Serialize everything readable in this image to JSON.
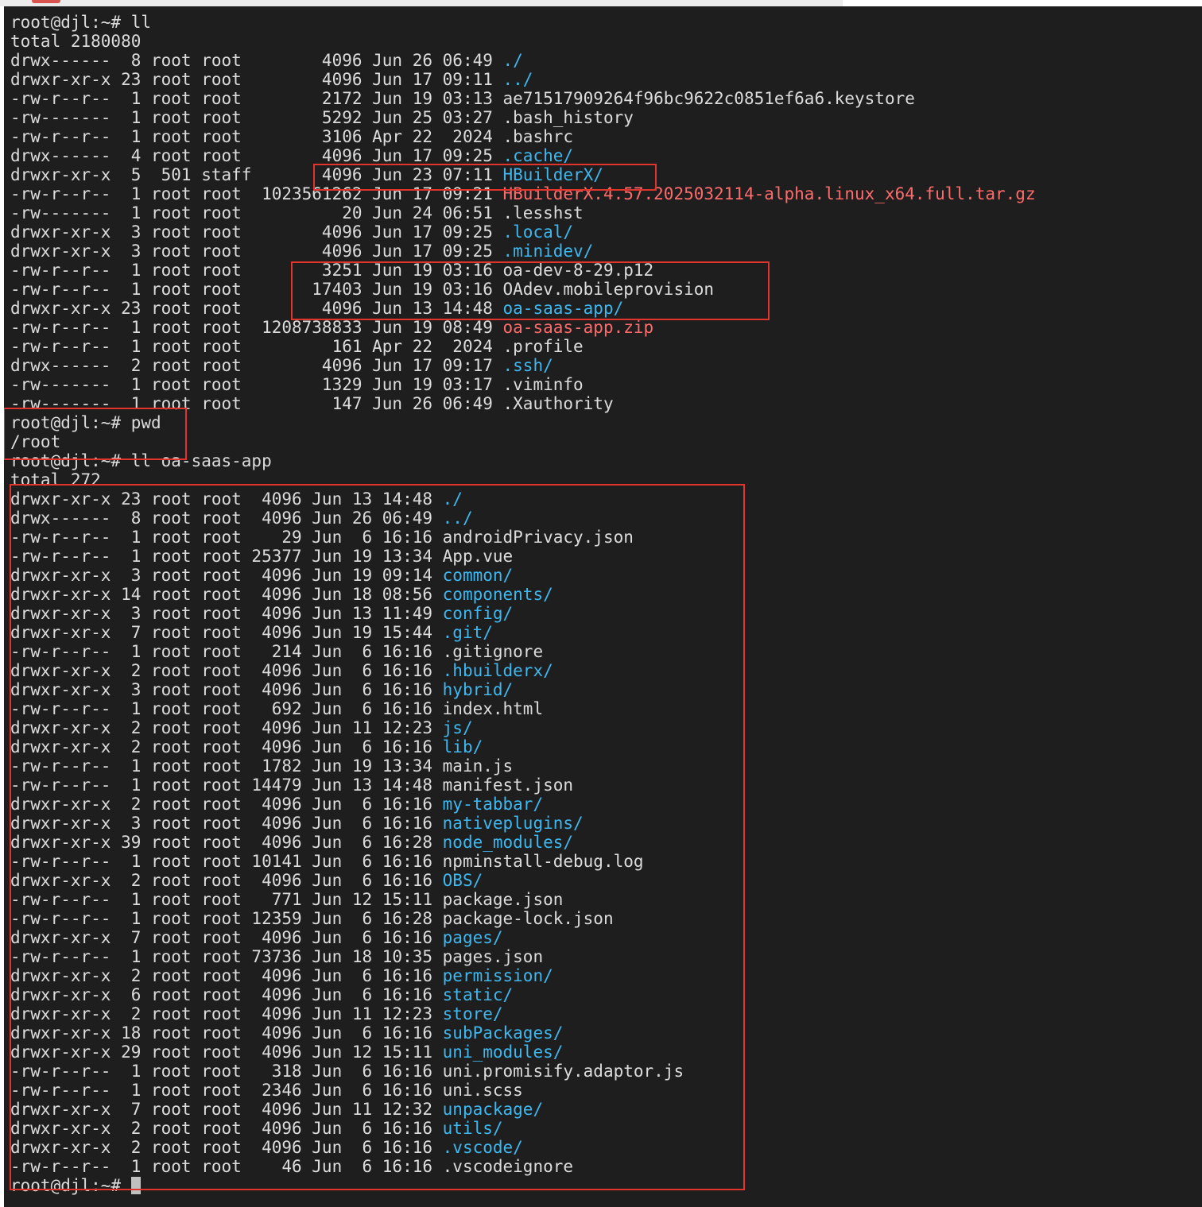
{
  "colors": {
    "background": "#1e1e1e",
    "text": "#dcdcdc",
    "directory": "#3eb8f0",
    "archive": "#ff6b6b",
    "highlight": "#e0342d"
  },
  "lines": [
    {
      "type": "prompt",
      "text": "root@djl:~# ll"
    },
    {
      "type": "plain",
      "text": "total 2180080"
    },
    {
      "type": "entry",
      "prefix": "drwx------  8 root root        4096 Jun 26 06:49 ",
      "name": "./",
      "kind": "dir"
    },
    {
      "type": "entry",
      "prefix": "drwxr-xr-x 23 root root        4096 Jun 17 09:11 ",
      "name": "../",
      "kind": "dir"
    },
    {
      "type": "entry",
      "prefix": "-rw-r--r--  1 root root        2172 Jun 19 03:13 ",
      "name": "ae71517909264f96bc9622c0851ef6a6.keystore",
      "kind": "file"
    },
    {
      "type": "entry",
      "prefix": "-rw-------  1 root root        5292 Jun 25 03:27 ",
      "name": ".bash_history",
      "kind": "file"
    },
    {
      "type": "entry",
      "prefix": "-rw-r--r--  1 root root        3106 Apr 22  2024 ",
      "name": ".bashrc",
      "kind": "file"
    },
    {
      "type": "entry",
      "prefix": "drwx------  4 root root        4096 Jun 17 09:25 ",
      "name": ".cache/",
      "kind": "dir"
    },
    {
      "type": "entry",
      "prefix": "drwxr-xr-x  5  501 staff       4096 Jun 23 07:11 ",
      "name": "HBuilderX/",
      "kind": "dir"
    },
    {
      "type": "entry",
      "prefix": "-rw-r--r--  1 root root  1023561262 Jun 17 09:21 ",
      "name": "HBuilderX.4.57.2025032114-alpha.linux_x64.full.tar.gz",
      "kind": "archive"
    },
    {
      "type": "entry",
      "prefix": "-rw-------  1 root root          20 Jun 24 06:51 ",
      "name": ".lesshst",
      "kind": "file"
    },
    {
      "type": "entry",
      "prefix": "drwxr-xr-x  3 root root        4096 Jun 17 09:25 ",
      "name": ".local/",
      "kind": "dir"
    },
    {
      "type": "entry",
      "prefix": "drwxr-xr-x  3 root root        4096 Jun 17 09:25 ",
      "name": ".minidev/",
      "kind": "dir"
    },
    {
      "type": "entry",
      "prefix": "-rw-r--r--  1 root root        3251 Jun 19 03:16 ",
      "name": "oa-dev-8-29.p12",
      "kind": "file"
    },
    {
      "type": "entry",
      "prefix": "-rw-r--r--  1 root root       17403 Jun 19 03:16 ",
      "name": "OAdev.mobileprovision",
      "kind": "file"
    },
    {
      "type": "entry",
      "prefix": "drwxr-xr-x 23 root root        4096 Jun 13 14:48 ",
      "name": "oa-saas-app/",
      "kind": "dir"
    },
    {
      "type": "entry",
      "prefix": "-rw-r--r--  1 root root  1208738833 Jun 19 08:49 ",
      "name": "oa-saas-app.zip",
      "kind": "archive"
    },
    {
      "type": "entry",
      "prefix": "-rw-r--r--  1 root root         161 Apr 22  2024 ",
      "name": ".profile",
      "kind": "file"
    },
    {
      "type": "entry",
      "prefix": "drwx------  2 root root        4096 Jun 17 09:17 ",
      "name": ".ssh/",
      "kind": "dir"
    },
    {
      "type": "entry",
      "prefix": "-rw-------  1 root root        1329 Jun 19 03:17 ",
      "name": ".viminfo",
      "kind": "file"
    },
    {
      "type": "entry",
      "prefix": "-rw-------  1 root root         147 Jun 26 06:49 ",
      "name": ".Xauthority",
      "kind": "file"
    },
    {
      "type": "prompt",
      "text": "root@djl:~# pwd"
    },
    {
      "type": "plain",
      "text": "/root"
    },
    {
      "type": "prompt",
      "text": "root@djl:~# ll oa-saas-app"
    },
    {
      "type": "plain",
      "text": "total 272"
    },
    {
      "type": "entry",
      "prefix": "drwxr-xr-x 23 root root  4096 Jun 13 14:48 ",
      "name": "./",
      "kind": "dir"
    },
    {
      "type": "entry",
      "prefix": "drwx------  8 root root  4096 Jun 26 06:49 ",
      "name": "../",
      "kind": "dir"
    },
    {
      "type": "entry",
      "prefix": "-rw-r--r--  1 root root    29 Jun  6 16:16 ",
      "name": "androidPrivacy.json",
      "kind": "file"
    },
    {
      "type": "entry",
      "prefix": "-rw-r--r--  1 root root 25377 Jun 19 13:34 ",
      "name": "App.vue",
      "kind": "file"
    },
    {
      "type": "entry",
      "prefix": "drwxr-xr-x  3 root root  4096 Jun 19 09:14 ",
      "name": "common/",
      "kind": "dir"
    },
    {
      "type": "entry",
      "prefix": "drwxr-xr-x 14 root root  4096 Jun 18 08:56 ",
      "name": "components/",
      "kind": "dir"
    },
    {
      "type": "entry",
      "prefix": "drwxr-xr-x  3 root root  4096 Jun 13 11:49 ",
      "name": "config/",
      "kind": "dir"
    },
    {
      "type": "entry",
      "prefix": "drwxr-xr-x  7 root root  4096 Jun 19 15:44 ",
      "name": ".git/",
      "kind": "dir"
    },
    {
      "type": "entry",
      "prefix": "-rw-r--r--  1 root root   214 Jun  6 16:16 ",
      "name": ".gitignore",
      "kind": "file"
    },
    {
      "type": "entry",
      "prefix": "drwxr-xr-x  2 root root  4096 Jun  6 16:16 ",
      "name": ".hbuilderx/",
      "kind": "dir"
    },
    {
      "type": "entry",
      "prefix": "drwxr-xr-x  3 root root  4096 Jun  6 16:16 ",
      "name": "hybrid/",
      "kind": "dir"
    },
    {
      "type": "entry",
      "prefix": "-rw-r--r--  1 root root   692 Jun  6 16:16 ",
      "name": "index.html",
      "kind": "file"
    },
    {
      "type": "entry",
      "prefix": "drwxr-xr-x  2 root root  4096 Jun 11 12:23 ",
      "name": "js/",
      "kind": "dir"
    },
    {
      "type": "entry",
      "prefix": "drwxr-xr-x  2 root root  4096 Jun  6 16:16 ",
      "name": "lib/",
      "kind": "dir"
    },
    {
      "type": "entry",
      "prefix": "-rw-r--r--  1 root root  1782 Jun 19 13:34 ",
      "name": "main.js",
      "kind": "file"
    },
    {
      "type": "entry",
      "prefix": "-rw-r--r--  1 root root 14479 Jun 13 14:48 ",
      "name": "manifest.json",
      "kind": "file"
    },
    {
      "type": "entry",
      "prefix": "drwxr-xr-x  2 root root  4096 Jun  6 16:16 ",
      "name": "my-tabbar/",
      "kind": "dir"
    },
    {
      "type": "entry",
      "prefix": "drwxr-xr-x  3 root root  4096 Jun  6 16:16 ",
      "name": "nativeplugins/",
      "kind": "dir"
    },
    {
      "type": "entry",
      "prefix": "drwxr-xr-x 39 root root  4096 Jun  6 16:28 ",
      "name": "node_modules/",
      "kind": "dir"
    },
    {
      "type": "entry",
      "prefix": "-rw-r--r--  1 root root 10141 Jun  6 16:16 ",
      "name": "npminstall-debug.log",
      "kind": "file"
    },
    {
      "type": "entry",
      "prefix": "drwxr-xr-x  2 root root  4096 Jun  6 16:16 ",
      "name": "OBS/",
      "kind": "dir"
    },
    {
      "type": "entry",
      "prefix": "-rw-r--r--  1 root root   771 Jun 12 15:11 ",
      "name": "package.json",
      "kind": "file"
    },
    {
      "type": "entry",
      "prefix": "-rw-r--r--  1 root root 12359 Jun  6 16:28 ",
      "name": "package-lock.json",
      "kind": "file"
    },
    {
      "type": "entry",
      "prefix": "drwxr-xr-x  7 root root  4096 Jun  6 16:16 ",
      "name": "pages/",
      "kind": "dir"
    },
    {
      "type": "entry",
      "prefix": "-rw-r--r--  1 root root 73736 Jun 18 10:35 ",
      "name": "pages.json",
      "kind": "file"
    },
    {
      "type": "entry",
      "prefix": "drwxr-xr-x  2 root root  4096 Jun  6 16:16 ",
      "name": "permission/",
      "kind": "dir"
    },
    {
      "type": "entry",
      "prefix": "drwxr-xr-x  6 root root  4096 Jun  6 16:16 ",
      "name": "static/",
      "kind": "dir"
    },
    {
      "type": "entry",
      "prefix": "drwxr-xr-x  2 root root  4096 Jun 11 12:23 ",
      "name": "store/",
      "kind": "dir"
    },
    {
      "type": "entry",
      "prefix": "drwxr-xr-x 18 root root  4096 Jun  6 16:16 ",
      "name": "subPackages/",
      "kind": "dir"
    },
    {
      "type": "entry",
      "prefix": "drwxr-xr-x 29 root root  4096 Jun 12 15:11 ",
      "name": "uni_modules/",
      "kind": "dir"
    },
    {
      "type": "entry",
      "prefix": "-rw-r--r--  1 root root   318 Jun  6 16:16 ",
      "name": "uni.promisify.adaptor.js",
      "kind": "file"
    },
    {
      "type": "entry",
      "prefix": "-rw-r--r--  1 root root  2346 Jun  6 16:16 ",
      "name": "uni.scss",
      "kind": "file"
    },
    {
      "type": "entry",
      "prefix": "drwxr-xr-x  7 root root  4096 Jun 11 12:32 ",
      "name": "unpackage/",
      "kind": "dir"
    },
    {
      "type": "entry",
      "prefix": "drwxr-xr-x  2 root root  4096 Jun  6 16:16 ",
      "name": "utils/",
      "kind": "dir"
    },
    {
      "type": "entry",
      "prefix": "drwxr-xr-x  2 root root  4096 Jun  6 16:16 ",
      "name": ".vscode/",
      "kind": "dir"
    },
    {
      "type": "entry",
      "prefix": "-rw-r--r--  1 root root    46 Jun  6 16:16 ",
      "name": ".vscodeignore",
      "kind": "file"
    },
    {
      "type": "prompt-cursor",
      "text": "root@djl:~# "
    }
  ]
}
